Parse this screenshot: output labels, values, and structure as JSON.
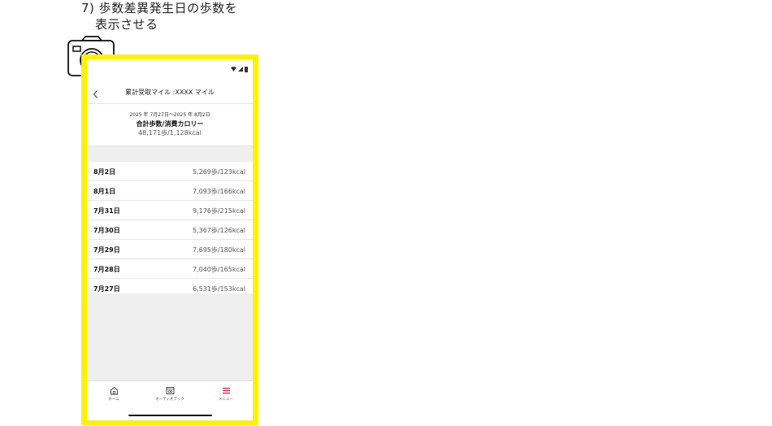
{
  "caption": {
    "line1": "7) 歩数差異発生日の歩数を",
    "line2": "表示させる"
  },
  "header": {
    "title": "累計受取マイル :XXXX マイル",
    "back_icon": "chevron-left-icon"
  },
  "summary": {
    "range": "2025 年 7月27日～2025 年 8月2日",
    "label": "合計歩数/消費カロリー",
    "value": "48,171歩/1,128kcal"
  },
  "rows": [
    {
      "date": "8月2日",
      "value": "5,269歩/123kcal"
    },
    {
      "date": "8月1日",
      "value": "7,093歩/166kcal"
    },
    {
      "date": "7月31日",
      "value": "9,176歩/215kcal"
    },
    {
      "date": "7月30日",
      "value": "5,367歩/126kcal"
    },
    {
      "date": "7月29日",
      "value": "7,695歩/180kcal"
    },
    {
      "date": "7月28日",
      "value": "7,040歩/165kcal"
    },
    {
      "date": "7月27日",
      "value": "6,531歩/153kcal"
    }
  ],
  "tabs": [
    {
      "label": "ホーム",
      "icon": "home-icon"
    },
    {
      "label": "オーディオブック",
      "icon": "audiobook-icon"
    },
    {
      "label": "メニュー",
      "icon": "menu-icon"
    }
  ],
  "colors": {
    "frame": "#fff200",
    "accent": "#c8102e",
    "background_gray": "#efefef"
  }
}
